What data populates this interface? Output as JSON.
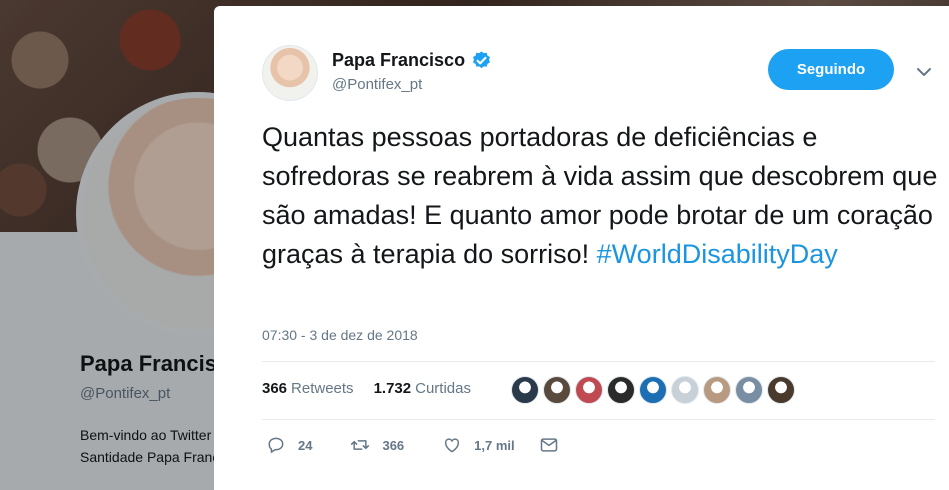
{
  "background_profile": {
    "name": "Papa Francisco",
    "handle": "@Pontifex_pt",
    "bio_line1": "Bem-vindo ao Twitter oficial de Sua",
    "bio_line2": "Santidade Papa Francisco"
  },
  "tweet": {
    "author_name": "Papa Francisco",
    "author_handle": "@Pontifex_pt",
    "verified_icon": "verified-badge-icon",
    "follow_button_label": "Seguindo",
    "text": "Quantas pessoas portadoras de deficiências e sofredoras se reabrem à vida assim que descobrem que são amadas! E quanto amor pode brotar de um coração graças à terapia do sorriso! ",
    "hashtag": "#WorldDisabilityDay",
    "timestamp": "07:30 - 3 de dez de 2018",
    "retweets_count": "366",
    "retweets_label": "Retweets",
    "likes_count": "1.732",
    "likes_label": "Curtidas",
    "liker_colors": [
      "#2a3a4a",
      "#5a4a3e",
      "#c04a52",
      "#2b2b2b",
      "#1d6fb3",
      "#c9d1d8",
      "#b89a80",
      "#7a8ea3",
      "#4a3a2e"
    ],
    "actions": {
      "reply_count": "24",
      "retweet_count": "366",
      "like_count": "1,7 mil"
    }
  },
  "colors": {
    "accent": "#1da1f2",
    "hashtag": "#1b95e0",
    "muted": "#657786"
  }
}
